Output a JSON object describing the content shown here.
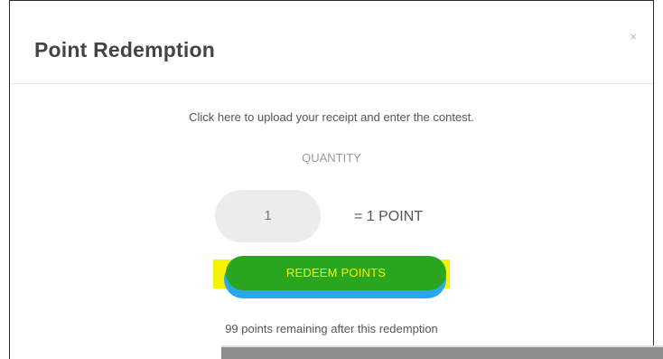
{
  "modal": {
    "title": "Point Redemption",
    "close_icon": "close-icon",
    "close_label": "×"
  },
  "content": {
    "instruction": "Click here to upload your receipt and enter the contest.",
    "quantity_label": "QUANTITY",
    "quantity_value": "1",
    "equals_text": "= 1 POINT",
    "redeem_label": "REDEEM POINTS",
    "remaining_text": "99 points remaining after this redemption"
  },
  "colors": {
    "button_green": "#2aa51e",
    "highlight_yellow": "#f6f200",
    "highlight_blue": "#2aa9e8",
    "button_text": "#f5f500"
  }
}
